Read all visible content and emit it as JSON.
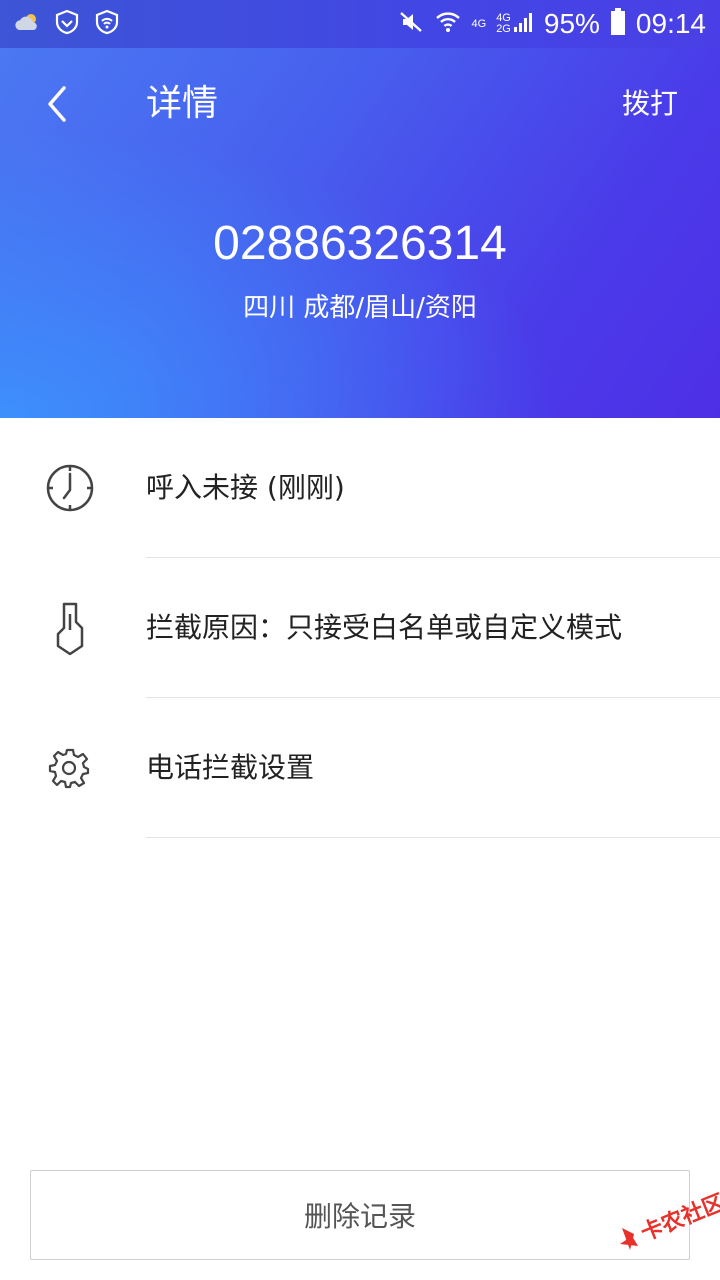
{
  "status_bar": {
    "network_labels": [
      "4G",
      "4G",
      "2G"
    ],
    "battery": "95%",
    "time": "09:14"
  },
  "header": {
    "title": "详情",
    "action_label": "拨打",
    "phone_number": "02886326314",
    "location": "四川 成都/眉山/资阳"
  },
  "details": [
    {
      "icon": "clock-icon",
      "text": "呼入未接  (刚刚)"
    },
    {
      "icon": "shield-block-icon",
      "text": "拦截原因：只接受白名单或自定义模式"
    },
    {
      "icon": "gear-icon",
      "text": "电话拦截设置"
    }
  ],
  "delete_button": "删除记录",
  "watermark": "卡农社区",
  "colors": {
    "header_gradient": [
      "#4b78f3",
      "#4a3be9"
    ],
    "text_primary": "#222222",
    "divider": "#e4e4e4"
  }
}
